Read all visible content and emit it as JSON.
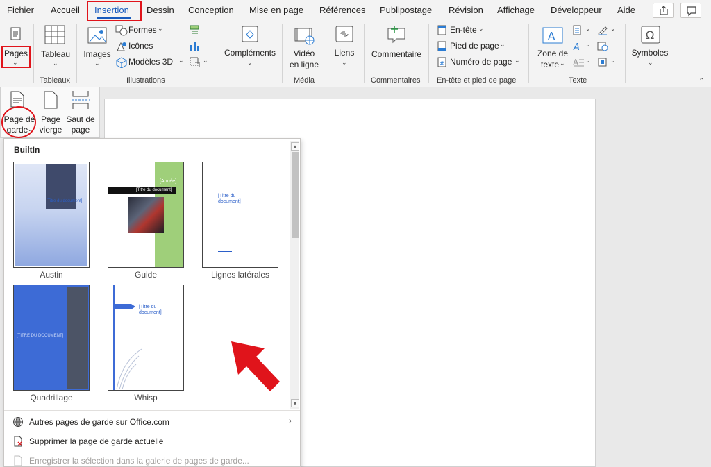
{
  "menu": {
    "tabs": [
      "Fichier",
      "Accueil",
      "Insertion",
      "Dessin",
      "Conception",
      "Mise en page",
      "Références",
      "Publipostage",
      "Révision",
      "Affichage",
      "Développeur",
      "Aide"
    ],
    "active_tab": "Insertion"
  },
  "ribbon": {
    "pages": {
      "label": "Pages"
    },
    "tableaux": {
      "button": "Tableau",
      "group": "Tableaux"
    },
    "illustrations": {
      "images": "Images",
      "formes": "Formes",
      "icones": "Icônes",
      "modeles3d": "Modèles 3D",
      "group": "Illustrations"
    },
    "complements": {
      "label": "Compléments"
    },
    "media": {
      "label_line1": "Vidéo",
      "label_line2": "en ligne",
      "group": "Média"
    },
    "liens": {
      "label": "Liens"
    },
    "commentaires": {
      "label": "Commentaire",
      "group": "Commentaires"
    },
    "entete": {
      "entete": "En-tête",
      "pied": "Pied de page",
      "numero": "Numéro de page",
      "group": "En-tête et pied de page"
    },
    "texte": {
      "zone_line1": "Zone de",
      "zone_line2": "texte",
      "group": "Texte"
    },
    "symboles": {
      "label": "Symboles"
    }
  },
  "pages_pane": {
    "page_garde_line1": "Page de",
    "page_garde_line2": "garde",
    "page_vierge_line1": "Page",
    "page_vierge_line2": "vierge",
    "saut_line1": "Saut de",
    "saut_line2": "page"
  },
  "gallery": {
    "heading": "BuiltIn",
    "items": [
      {
        "name": "Austin",
        "title": "[Titre du document]"
      },
      {
        "name": "Guide",
        "title": "[Titre du document]",
        "year": "[Année]"
      },
      {
        "name": "Lignes latérales",
        "title": "[Titre du document]"
      },
      {
        "name": "Quadrillage",
        "title": "[TITRE DU DOCUMENT]"
      },
      {
        "name": "Whisp",
        "title": "[Titre du document]"
      }
    ],
    "menu_items": [
      "Autres pages de garde sur Office.com",
      "Supprimer la page de garde actuelle",
      "Enregistrer la sélection dans la galerie de pages de garde..."
    ]
  },
  "colors": {
    "accent": "#185abd",
    "highlight": "#e0141b",
    "austin_blue": "#a9bde8",
    "guide_green": "#9fcf7a",
    "quadrillage_blue": "#3d6bd6"
  }
}
